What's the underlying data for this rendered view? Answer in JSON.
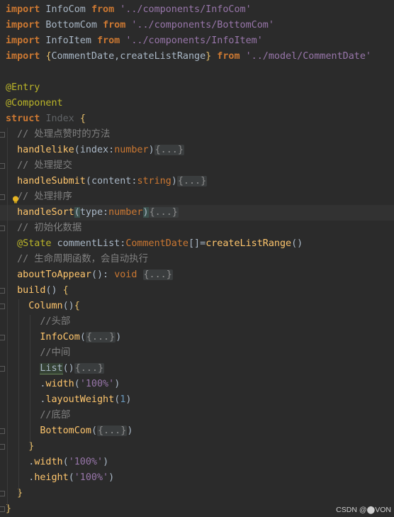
{
  "editor": {
    "lines": [
      {
        "parts": [
          [
            "kw",
            "import"
          ],
          [
            "cls",
            " InfoCom "
          ],
          [
            "kw",
            "from"
          ],
          [
            "cls",
            " "
          ],
          [
            "strp",
            "'../components/InfoCom'"
          ]
        ]
      },
      {
        "parts": [
          [
            "kw",
            "import"
          ],
          [
            "cls",
            " BottomCom "
          ],
          [
            "kw",
            "from"
          ],
          [
            "cls",
            " "
          ],
          [
            "strp",
            "'../components/BottomCom'"
          ]
        ]
      },
      {
        "parts": [
          [
            "kw",
            "import"
          ],
          [
            "cls",
            " InfoItem "
          ],
          [
            "kw",
            "from"
          ],
          [
            "cls",
            " "
          ],
          [
            "strp",
            "'../components/InfoItem'"
          ]
        ]
      },
      {
        "parts": [
          [
            "kw",
            "import"
          ],
          [
            "cls",
            " "
          ],
          [
            "brace-y",
            "{"
          ],
          [
            "cls",
            "CommentDate,createListRange"
          ],
          [
            "brace-y",
            "}"
          ],
          [
            "cls",
            " "
          ],
          [
            "kw",
            "from"
          ],
          [
            "cls",
            " "
          ],
          [
            "strp",
            "'../model/CommentDate'"
          ]
        ]
      },
      {
        "parts": []
      },
      {
        "parts": [
          [
            "ann",
            "@Entry"
          ]
        ]
      },
      {
        "parts": [
          [
            "ann",
            "@Component"
          ]
        ]
      },
      {
        "parts": [
          [
            "kw",
            "struct"
          ],
          [
            "cls",
            " "
          ],
          [
            "dim",
            "Index"
          ],
          [
            "cls",
            " "
          ],
          [
            "brace-y",
            "{"
          ]
        ]
      },
      {
        "parts": [
          [
            "cls",
            "  "
          ],
          [
            "cmt",
            "// 处理点赞时的方法"
          ]
        ]
      },
      {
        "parts": [
          [
            "cls",
            "  "
          ],
          [
            "fnc",
            "handlelike"
          ],
          [
            "cls",
            "("
          ],
          [
            "cls",
            "index:"
          ],
          [
            "type",
            "number"
          ],
          [
            "cls",
            ")"
          ],
          [
            "fold-chip",
            "{...}"
          ]
        ]
      },
      {
        "parts": [
          [
            "cls",
            "  "
          ],
          [
            "cmt",
            "// 处理提交"
          ]
        ]
      },
      {
        "parts": [
          [
            "cls",
            "  "
          ],
          [
            "fnc",
            "handleSubmit"
          ],
          [
            "cls",
            "("
          ],
          [
            "cls",
            "content:"
          ],
          [
            "type",
            "string"
          ],
          [
            "cls",
            ")"
          ],
          [
            "fold-chip",
            "{...}"
          ]
        ]
      },
      {
        "parts": [
          [
            "cls",
            "  "
          ],
          [
            "cmt",
            "// 处理排序"
          ]
        ]
      },
      {
        "hl": true,
        "parts": [
          [
            "cls",
            "  "
          ],
          [
            "fnc",
            "handleSort"
          ],
          [
            "match",
            "("
          ],
          [
            "cls",
            "type:"
          ],
          [
            "type",
            "number"
          ],
          [
            "match",
            ")"
          ],
          [
            "fold-chip",
            "{...}"
          ]
        ]
      },
      {
        "parts": [
          [
            "cls",
            "  "
          ],
          [
            "cmt",
            "// 初始化数据"
          ]
        ]
      },
      {
        "parts": [
          [
            "cls",
            "  "
          ],
          [
            "ann",
            "@State"
          ],
          [
            "cls",
            " commentList:"
          ],
          [
            "type",
            "CommentDate"
          ],
          [
            "cls",
            "[]="
          ],
          [
            "fnc",
            "createListRange"
          ],
          [
            "cls",
            "()"
          ]
        ]
      },
      {
        "parts": [
          [
            "cls",
            "  "
          ],
          [
            "cmt",
            "// 生命周期函数，会自动执行"
          ]
        ]
      },
      {
        "parts": [
          [
            "cls",
            "  "
          ],
          [
            "fnc",
            "aboutToAppear"
          ],
          [
            "cls",
            "(): "
          ],
          [
            "kw2",
            "void"
          ],
          [
            "cls",
            " "
          ],
          [
            "fold-chip",
            "{...}"
          ]
        ]
      },
      {
        "parts": [
          [
            "cls",
            "  "
          ],
          [
            "fnc",
            "build"
          ],
          [
            "cls",
            "() "
          ],
          [
            "brace-y",
            "{"
          ]
        ]
      },
      {
        "parts": [
          [
            "cls",
            "    "
          ],
          [
            "fnc",
            "Column"
          ],
          [
            "cls",
            "()"
          ],
          [
            "brace-y",
            "{"
          ]
        ]
      },
      {
        "parts": [
          [
            "cls",
            "      "
          ],
          [
            "cmt",
            "//头部"
          ]
        ]
      },
      {
        "parts": [
          [
            "cls",
            "      "
          ],
          [
            "fnc",
            "InfoCom"
          ],
          [
            "cls",
            "("
          ],
          [
            "fold-chip",
            "{...}"
          ],
          [
            "cls",
            ")"
          ]
        ]
      },
      {
        "parts": [
          [
            "cls",
            "      "
          ],
          [
            "cmt",
            "//中间"
          ]
        ]
      },
      {
        "parts": [
          [
            "cls",
            "      "
          ],
          [
            "list-hl",
            "List"
          ],
          [
            "cls",
            "()"
          ],
          [
            "fold-chip",
            "{...}"
          ]
        ]
      },
      {
        "parts": [
          [
            "cls",
            "      ."
          ],
          [
            "fnc",
            "width"
          ],
          [
            "cls",
            "("
          ],
          [
            "strp",
            "'100%'"
          ],
          [
            "cls",
            ")"
          ]
        ]
      },
      {
        "parts": [
          [
            "cls",
            "      ."
          ],
          [
            "fnc",
            "layoutWeight"
          ],
          [
            "cls",
            "("
          ],
          [
            "num",
            "1"
          ],
          [
            "cls",
            ")"
          ]
        ]
      },
      {
        "parts": [
          [
            "cls",
            "      "
          ],
          [
            "cmt",
            "//底部"
          ]
        ]
      },
      {
        "parts": [
          [
            "cls",
            "      "
          ],
          [
            "fnc",
            "BottomCom"
          ],
          [
            "cls",
            "("
          ],
          [
            "fold-chip",
            "{...}"
          ],
          [
            "cls",
            ")"
          ]
        ]
      },
      {
        "parts": [
          [
            "cls",
            "    "
          ],
          [
            "brace-y",
            "}"
          ]
        ]
      },
      {
        "parts": [
          [
            "cls",
            "    ."
          ],
          [
            "fnc",
            "width"
          ],
          [
            "cls",
            "("
          ],
          [
            "strp",
            "'100%'"
          ],
          [
            "cls",
            ")"
          ]
        ]
      },
      {
        "parts": [
          [
            "cls",
            "    ."
          ],
          [
            "fnc",
            "height"
          ],
          [
            "cls",
            "("
          ],
          [
            "strp",
            "'100%'"
          ],
          [
            "cls",
            ")"
          ]
        ]
      },
      {
        "parts": [
          [
            "cls",
            "  "
          ],
          [
            "brace-y",
            "}"
          ]
        ]
      },
      {
        "parts": [
          [
            "brace-y",
            "}"
          ]
        ]
      }
    ]
  },
  "watermark": "CSDN @⬤VON",
  "icons": {
    "bulb": "lightbulb-icon"
  }
}
